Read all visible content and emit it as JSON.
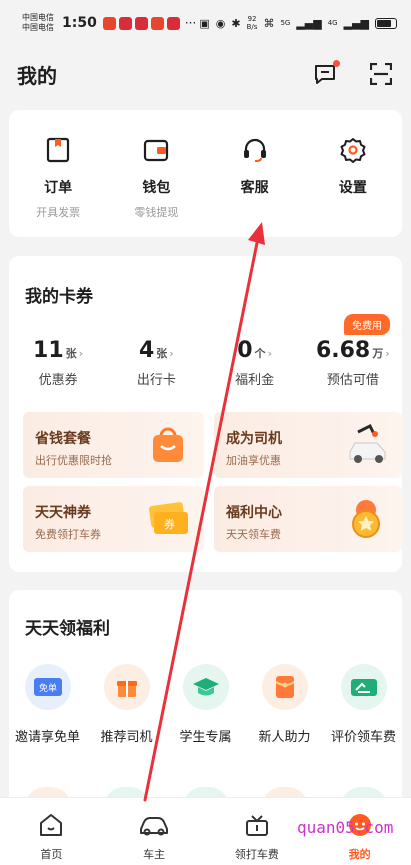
{
  "status_bar": {
    "carrier_1": "中国电信",
    "carrier_2": "中国电信",
    "time": "1:50",
    "dots": "···",
    "speed_value": "92",
    "speed_unit": "B/s",
    "signal_1": "5G",
    "signal_2": "4G"
  },
  "header": {
    "title": "我的"
  },
  "quick_actions": [
    {
      "label": "订单",
      "sub": "开具发票"
    },
    {
      "label": "钱包",
      "sub": "零钱提现"
    },
    {
      "label": "客服",
      "sub": ""
    },
    {
      "label": "设置",
      "sub": ""
    }
  ],
  "coupons": {
    "title": "我的卡券",
    "badge": "免费用",
    "stats": [
      {
        "value": "11",
        "unit": "张",
        "label": "优惠券"
      },
      {
        "value": "4",
        "unit": "张",
        "label": "出行卡"
      },
      {
        "value": "0",
        "unit": "个",
        "label": "福利金"
      },
      {
        "value": "6.68",
        "unit": "万",
        "label": "预估可借"
      }
    ],
    "promos": [
      {
        "title": "省钱套餐",
        "sub": "出行优惠限时抢"
      },
      {
        "title": "成为司机",
        "sub": "加油享优惠"
      },
      {
        "title": "天天神券",
        "sub": "免费领打车券"
      },
      {
        "title": "福利中心",
        "sub": "天天领车费"
      }
    ]
  },
  "welfare": {
    "title": "天天领福利",
    "items": [
      {
        "label": "邀请享免单",
        "icon": "free-ride-ticket-icon",
        "color": "#e7effb"
      },
      {
        "label": "推荐司机",
        "icon": "gift-box-icon",
        "color": "#fdeee3"
      },
      {
        "label": "学生专属",
        "icon": "graduation-cap-icon",
        "color": "#e4f6ef"
      },
      {
        "label": "新人助力",
        "icon": "red-envelope-icon",
        "color": "#fdeee3"
      },
      {
        "label": "评价领车费",
        "icon": "review-ticket-icon",
        "color": "#e4f6ef"
      }
    ],
    "free_ticket_text": "免单"
  },
  "tabbar": [
    {
      "label": "首页",
      "active": false
    },
    {
      "label": "车主",
      "active": false
    },
    {
      "label": "领打车费",
      "active": false
    },
    {
      "label": "我的",
      "active": true
    }
  ],
  "watermark": "quan05.com",
  "colors": {
    "accent": "#ff5a1f",
    "badge": "#ff6a2a",
    "annotation_arrow": "#e8313a"
  }
}
